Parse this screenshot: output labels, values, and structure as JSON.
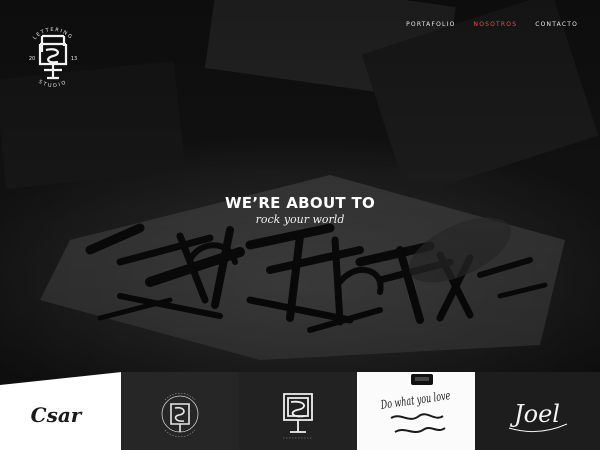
{
  "brand": {
    "logo_text_top": "LETTERING",
    "logo_text_bottom": "STUDIO",
    "logo_year_left": "20",
    "logo_year_right": "13"
  },
  "nav": {
    "items": [
      {
        "label": "PORTAFOLIO",
        "active": false
      },
      {
        "label": "NOSOTROS",
        "active": true
      },
      {
        "label": "CONTACTO",
        "active": false
      }
    ],
    "active_color": "#e8523a"
  },
  "hero": {
    "title": "WE’RE ABOUT TO",
    "subtitle": "rock your world"
  },
  "portfolio": {
    "thumbnails": [
      {
        "name": "csar-logo",
        "text": "Csar"
      },
      {
        "name": "monogram-badge-dark",
        "text": ""
      },
      {
        "name": "monogram-badge-linework",
        "text": ""
      },
      {
        "name": "do-what-you-love-lettering",
        "text": "Do what you love"
      },
      {
        "name": "joel-script-logo",
        "text": "Joel"
      }
    ]
  }
}
